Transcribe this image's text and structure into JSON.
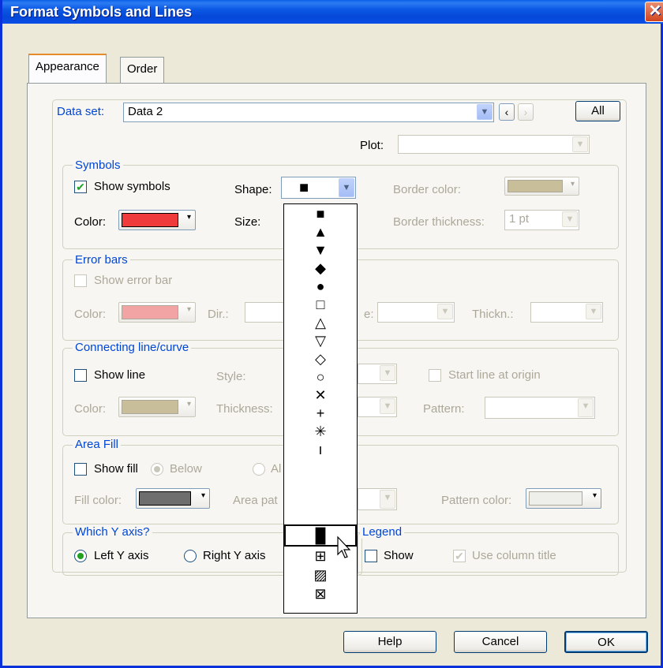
{
  "window": {
    "title": "Format Symbols and Lines",
    "close_glyph": "✕"
  },
  "tabs": [
    {
      "label": "Appearance"
    },
    {
      "label": "Order"
    }
  ],
  "dataset": {
    "label": "Data set:",
    "value": "Data 2",
    "all_label": "All",
    "plot_label": "Plot:"
  },
  "symbols": {
    "group_label": "Symbols",
    "show_label": "Show symbols",
    "shape_label": "Shape:",
    "color_label": "Color:",
    "size_label": "Size:",
    "border_color_label": "Border color:",
    "border_thickness_label": "Border thickness:",
    "border_thickness_value": "1 pt",
    "color_hex": "#ef3b3b",
    "border_color_hex": "#c8bf9a"
  },
  "error_bars": {
    "group_label": "Error bars",
    "show_label": "Show error bar",
    "color_label": "Color:",
    "dir_label": "Dir.:",
    "style_label_fragment": "e:",
    "thick_label": "Thickn.:",
    "color_hex": "#f2a3a3"
  },
  "connecting": {
    "group_label": "Connecting line/curve",
    "show_label": "Show line",
    "style_label": "Style:",
    "start_label": "Start line at origin",
    "color_label": "Color:",
    "thickness_label": "Thickness:",
    "pattern_label": "Pattern:",
    "color_hex": "#c8bf9a"
  },
  "area_fill": {
    "group_label": "Area Fill",
    "show_label": "Show fill",
    "below_label": "Below",
    "above_label_fragment": "Al",
    "fill_color_label": "Fill color:",
    "area_pattern_label": "Area pat",
    "pattern_color_label": "Pattern color:",
    "fill_color_hex": "#6e6e6e"
  },
  "y_axis": {
    "group_label": "Which Y axis?",
    "left_label": "Left Y axis",
    "right_label": "Right Y axis"
  },
  "legend": {
    "group_label": "Legend",
    "show_label": "Show",
    "use_title_label": "Use column title"
  },
  "shape_dropdown": {
    "current": "■",
    "options": [
      "■",
      "▲",
      "▼",
      "◆",
      "●",
      "□",
      "△",
      "▽",
      "◇",
      "○",
      "✕",
      "+",
      "✳",
      "ı",
      "█",
      "⊞",
      "▨",
      "⊠"
    ],
    "highlighted_index": 14
  },
  "buttons": {
    "help": "Help",
    "cancel": "Cancel",
    "ok": "OK"
  }
}
